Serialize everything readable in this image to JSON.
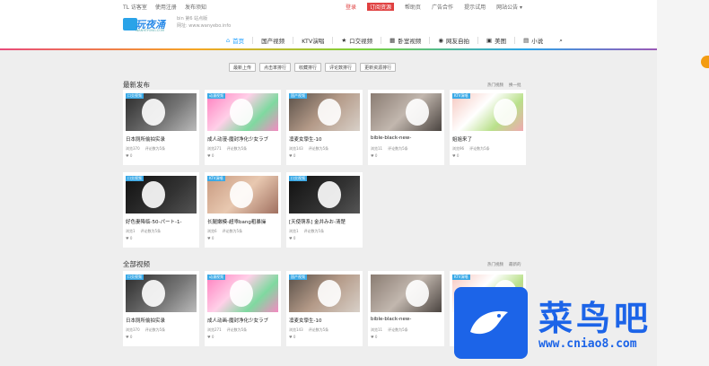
{
  "topbar": {
    "left_links": [
      "TL 访客室",
      "使用注册",
      "发布须知"
    ],
    "right_links": [
      "登录",
      "订阅资源",
      "帮助页",
      "广告合作",
      "提示试用",
      "网站公告 ▾"
    ]
  },
  "header": {
    "logo_text": "玩夜涌",
    "logo_sub": "WANYEYONG.COM",
    "meta_line1": "bin 第6 站点版",
    "meta_line2": "网址: www.wanyebo.info"
  },
  "nav": [
    {
      "icon": "home-icon",
      "label": "首页",
      "active": true
    },
    {
      "icon": "",
      "label": "国产视频",
      "active": false
    },
    {
      "icon": "",
      "label": "KTV演唱",
      "active": false
    },
    {
      "icon": "star-icon",
      "label": "口交视频",
      "active": false
    },
    {
      "icon": "grid-icon",
      "label": "卧室视频",
      "active": false
    },
    {
      "icon": "camera-icon",
      "label": "网友自拍",
      "active": false
    },
    {
      "icon": "image-icon",
      "label": "美图",
      "active": false
    },
    {
      "icon": "book-icon",
      "label": "小说",
      "active": false
    },
    {
      "icon": "search-icon",
      "label": "",
      "active": false
    }
  ],
  "filters": [
    "最新上传",
    "点击率排行",
    "收藏排行",
    "评论数排行",
    "更新资源排行"
  ],
  "section1": {
    "title": "最新发布",
    "tools": [
      "热门视频",
      "换一批"
    ]
  },
  "section2": {
    "title": "全部视频",
    "tools": [
      "热门视频",
      "最新的"
    ]
  },
  "row1": [
    {
      "tag": "口交视频",
      "title": "日本厕所偷拍实录",
      "views": "浏览370",
      "comments": "评论数为5条",
      "likes": "0",
      "thumb": "t-dark"
    },
    {
      "tag": "动漫视频",
      "title": "成人动漫-魔封净化少女ラブ",
      "views": "浏览271",
      "comments": "评论数为5条",
      "likes": "0",
      "thumb": "t-pink"
    },
    {
      "tag": "国产视频",
      "title": "凛麦女學生-10",
      "views": "浏览143",
      "comments": "评论数为5条",
      "likes": "0",
      "thumb": "t-mid"
    },
    {
      "tag": "",
      "title": "bible-black-new-",
      "views": "浏览11",
      "comments": "评论数为5条",
      "likes": "0",
      "thumb": "t-gray"
    },
    {
      "tag": "KTV演唱",
      "title": "姐姐来了",
      "views": "浏览96",
      "comments": "评论数为5条",
      "likes": "0",
      "thumb": "t-light"
    }
  ],
  "row2": [
    {
      "tag": "口交视频",
      "title": "好色妻降临-50-パート-1-",
      "views": "浏览1",
      "comments": "评论数为5条",
      "likes": "0",
      "thumb": "t-black"
    },
    {
      "tag": "KTV演唱",
      "title": "长腿嫩模-超乖bang粗暴操",
      "views": "浏览6",
      "comments": "评论数为5条",
      "likes": "0",
      "thumb": "t-skin"
    },
    {
      "tag": "口交视频",
      "title": "[天使萌系] 金井みお-清楚",
      "views": "浏览1",
      "comments": "评论数为5条",
      "likes": "0",
      "thumb": "t-black"
    }
  ],
  "row3": [
    {
      "tag": "口交视频",
      "title": "日本厕所偷拍实录",
      "views": "浏览370",
      "comments": "评论数为5条",
      "likes": "0",
      "thumb": "t-dark"
    },
    {
      "tag": "动漫视频",
      "title": "成人动画-魔封净化少女ラブ",
      "views": "浏览271",
      "comments": "评论数为5条",
      "likes": "0",
      "thumb": "t-pink"
    },
    {
      "tag": "国产视频",
      "title": "凛麦女學生-10",
      "views": "浏览143",
      "comments": "评论数为5条",
      "likes": "0",
      "thumb": "t-mid"
    },
    {
      "tag": "",
      "title": "bible-black-new-",
      "views": "浏览11",
      "comments": "评论数为5条",
      "likes": "0",
      "thumb": "t-gray"
    },
    {
      "tag": "KTV演唱",
      "title": "",
      "views": "",
      "comments": "",
      "likes": "",
      "thumb": "t-light"
    }
  ],
  "watermark": {
    "cn": "菜鸟吧",
    "url": "www.cniao8.com"
  }
}
